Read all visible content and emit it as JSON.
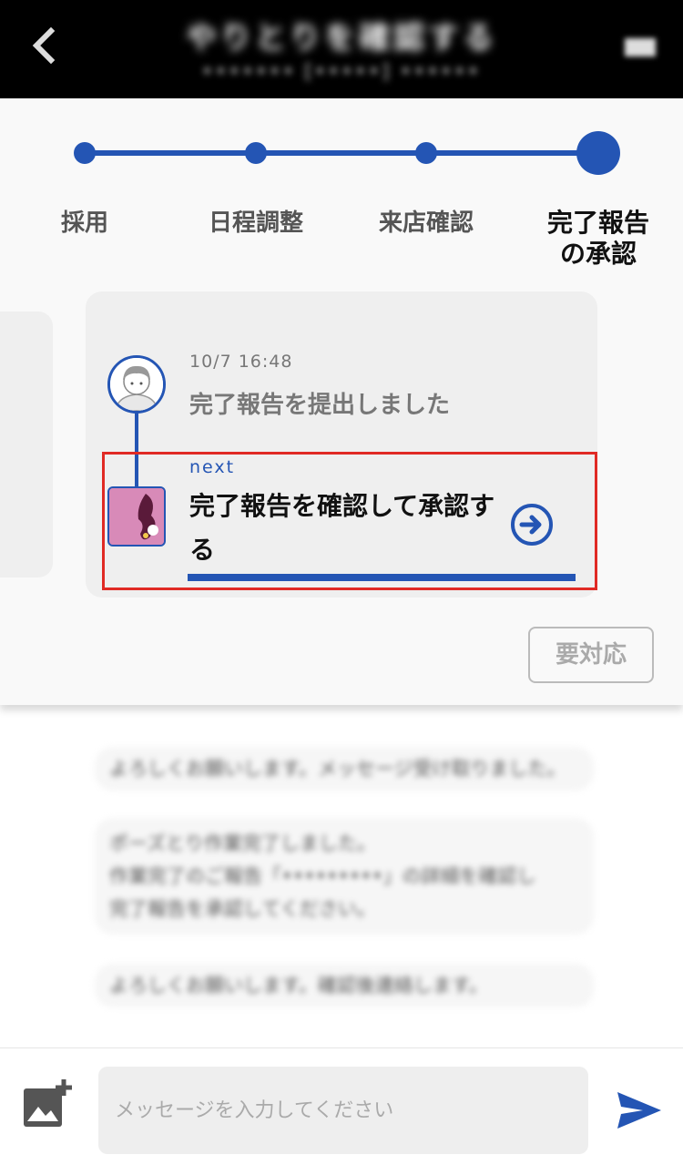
{
  "header": {
    "title": "やりとりを確認する",
    "subtitle": "••••••• [•••••] ••••••"
  },
  "steps": [
    {
      "label": "採用",
      "state": "done"
    },
    {
      "label": "日程調整",
      "state": "done"
    },
    {
      "label": "来店確認",
      "state": "done"
    },
    {
      "label": "完了報告\nの承認",
      "label_line1": "完了報告",
      "label_line2": "の承認",
      "state": "current"
    }
  ],
  "timeline": {
    "done_item": {
      "time": "10/7 16:48",
      "text": "完了報告を提出しました"
    },
    "next_item": {
      "tag": "next",
      "title": "完了報告を確認して承認する"
    }
  },
  "action_button": {
    "label": "要対応"
  },
  "messages": [
    "よろしくお願いします。メッセージ受け取りました。",
    "ポーズとり作業完了しました。\n作業完了のご報告「•••••••••」の詳細を確認し\n完了報告を承認してください。",
    "よろしくお願いします。確認後連絡します。"
  ],
  "composer": {
    "placeholder": "メッセージを入力してください"
  },
  "colors": {
    "accent": "#2455b4",
    "highlight": "#e02a24",
    "header_bg": "#000000"
  },
  "icons": {
    "back": "chevron-left-icon",
    "image_add": "image-add-icon",
    "send": "send-icon",
    "go": "arrow-circle-right-icon"
  }
}
